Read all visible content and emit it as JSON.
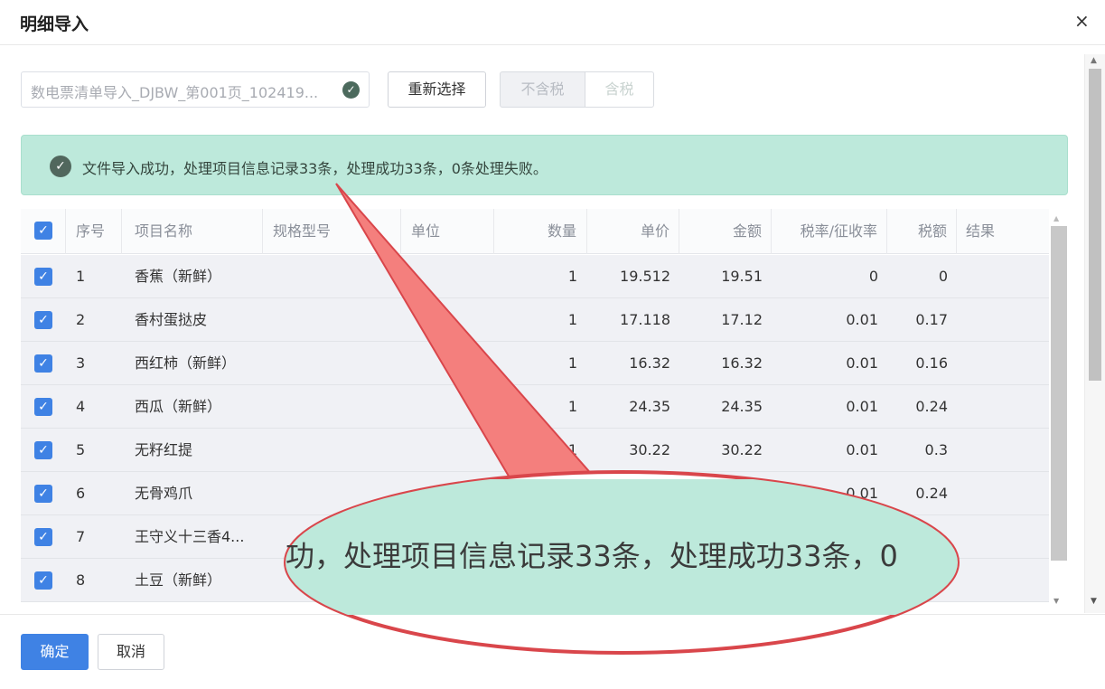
{
  "dialog": {
    "title": "明细导入",
    "close_icon": "close-icon"
  },
  "toolbar": {
    "file_name": "数电票清单导入_DJBW_第001页_102419...",
    "file_icon": "check-circle-icon",
    "reselect_label": "重新选择",
    "tax_excluded_label": "不含税",
    "tax_included_label": "含税"
  },
  "alert": {
    "icon": "check-circle-icon",
    "message": "文件导入成功，处理项目信息记录33条，处理成功33条，0条处理失败。"
  },
  "table": {
    "headers": {
      "index": "序号",
      "name": "项目名称",
      "spec": "规格型号",
      "unit": "单位",
      "quantity": "数量",
      "price": "单价",
      "amount": "金额",
      "tax_rate": "税率/征收率",
      "tax": "税额",
      "result": "结果"
    },
    "rows": [
      {
        "index": "1",
        "name": "香蕉（新鲜）",
        "quantity": "1",
        "price": "19.512",
        "amount": "19.51",
        "tax_rate": "0",
        "tax": "0"
      },
      {
        "index": "2",
        "name": "香村蛋挞皮",
        "quantity": "1",
        "price": "17.118",
        "amount": "17.12",
        "tax_rate": "0.01",
        "tax": "0.17"
      },
      {
        "index": "3",
        "name": "西红柿（新鲜）",
        "quantity": "1",
        "price": "16.32",
        "amount": "16.32",
        "tax_rate": "0.01",
        "tax": "0.16"
      },
      {
        "index": "4",
        "name": "西瓜（新鲜）",
        "quantity": "1",
        "price": "24.35",
        "amount": "24.35",
        "tax_rate": "0.01",
        "tax": "0.24"
      },
      {
        "index": "5",
        "name": "无籽红提",
        "quantity": "1",
        "price": "30.22",
        "amount": "30.22",
        "tax_rate": "0.01",
        "tax": "0.3"
      },
      {
        "index": "6",
        "name": "无骨鸡爪",
        "quantity": "",
        "price": "",
        "amount": "",
        "tax_rate": "0.01",
        "tax": "0.24"
      },
      {
        "index": "7",
        "name": "王守义十三香4...",
        "quantity": "",
        "price": "",
        "amount": "",
        "tax_rate": "",
        "tax": ""
      },
      {
        "index": "8",
        "name": "土豆（新鲜）",
        "quantity": "",
        "price": "",
        "amount": "",
        "tax_rate": "",
        "tax": ""
      }
    ]
  },
  "footer": {
    "ok_label": "确定",
    "cancel_label": "取消"
  },
  "callout": {
    "magnified_text": "功，处理项目信息记录33条，处理成功33条，0"
  },
  "colors": {
    "primary": "#3f82e4",
    "success_bg": "#bde9db",
    "callout_stroke": "#d9464b",
    "callout_fill": "#f47f7d"
  }
}
